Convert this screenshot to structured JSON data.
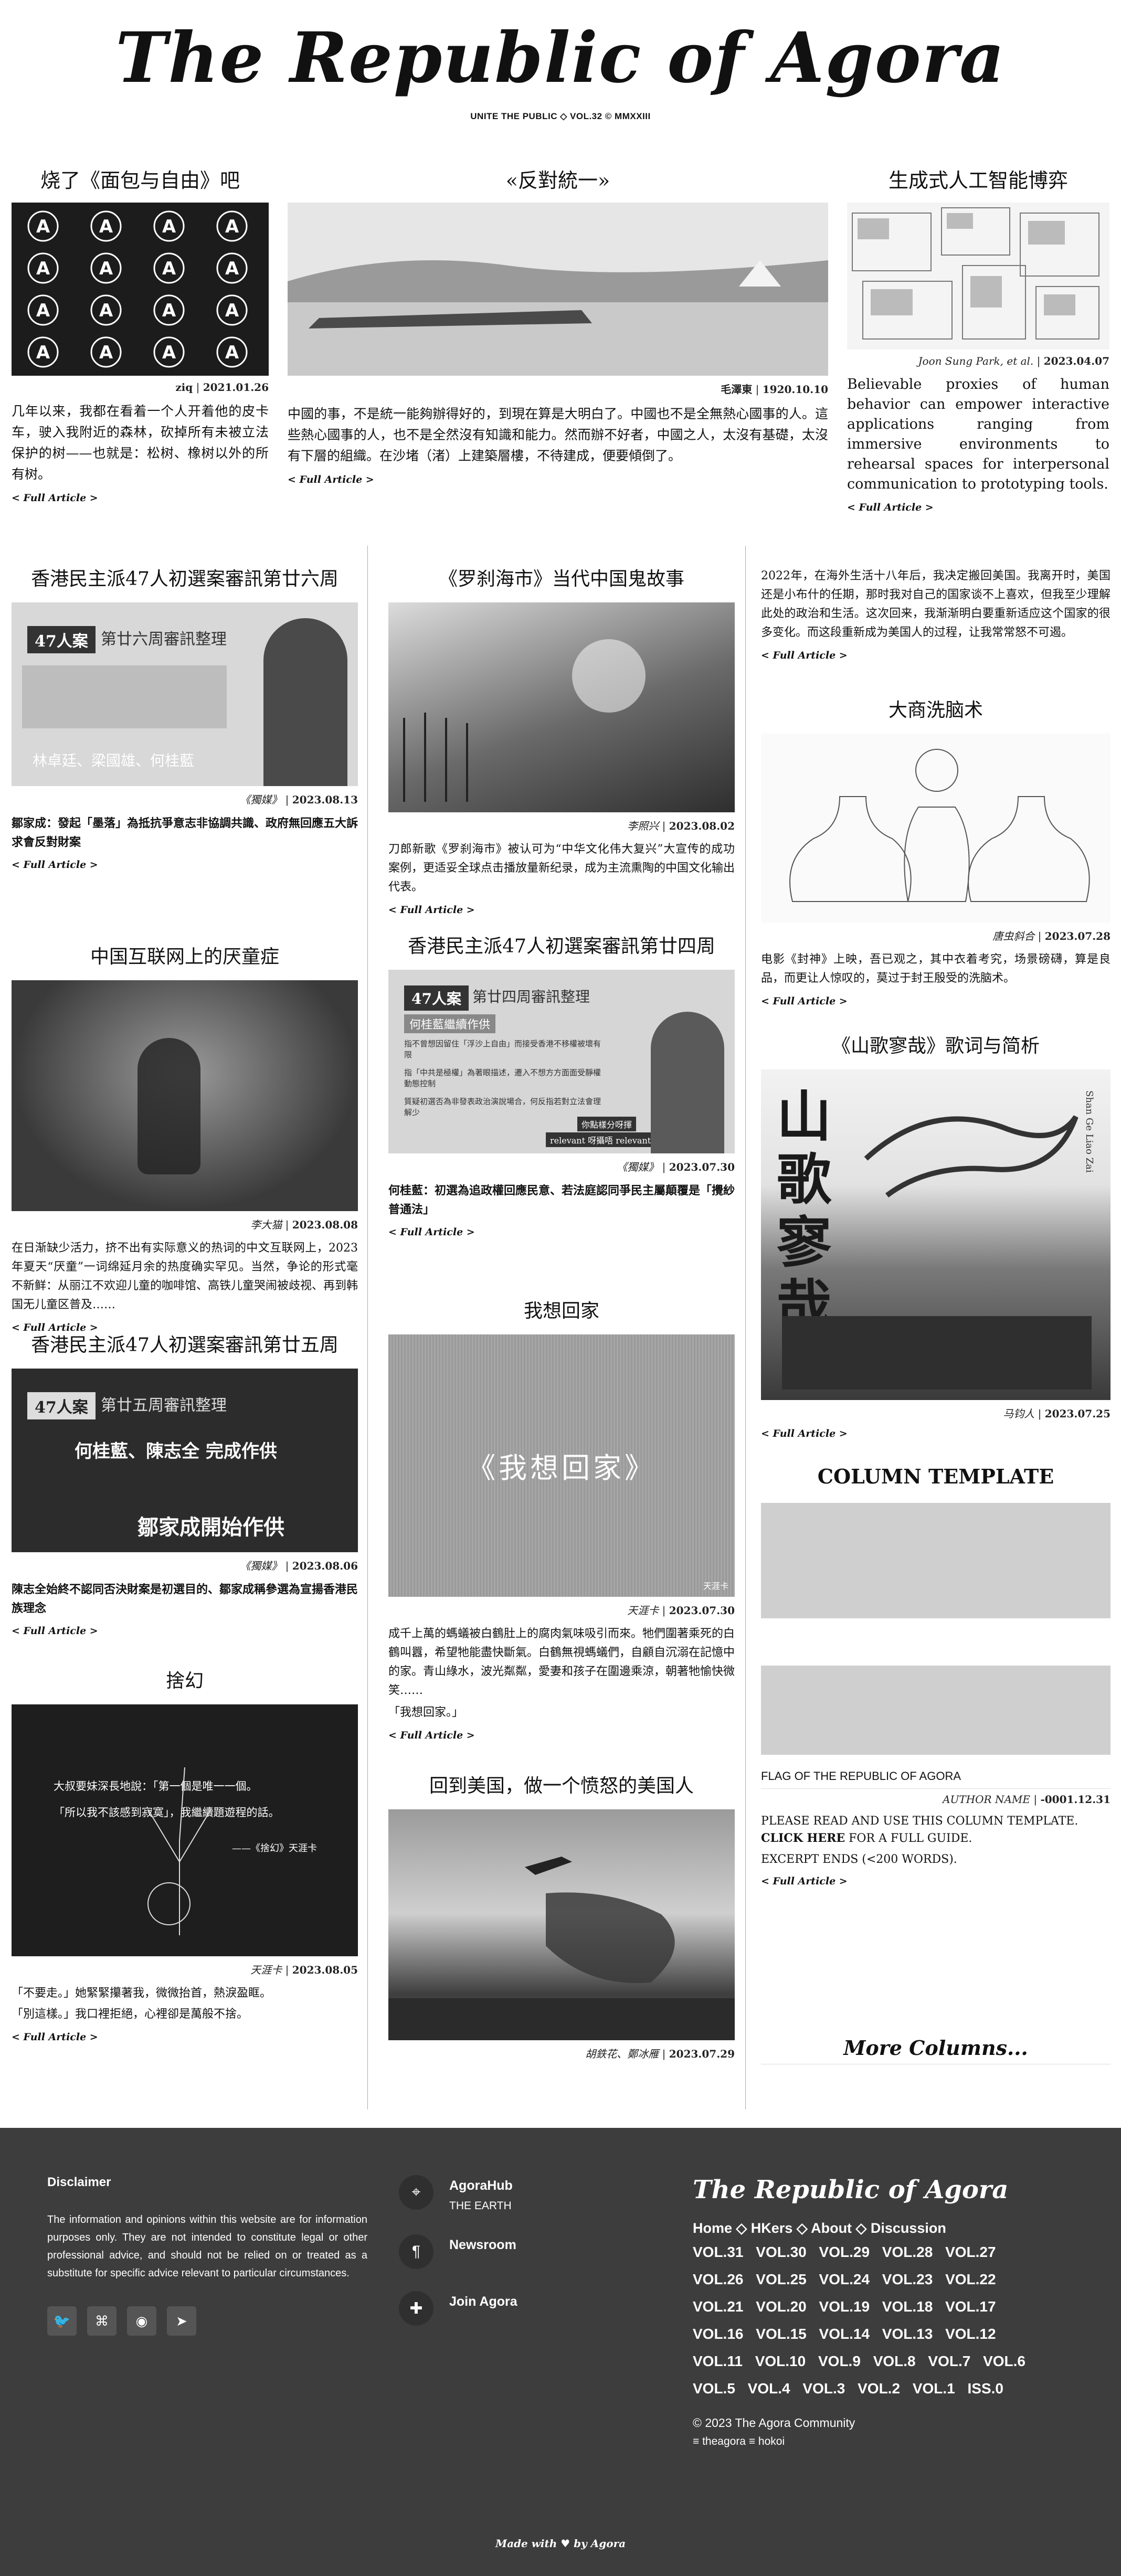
{
  "masthead": {
    "title": "The Republic of Agora",
    "tagline": "UNITE THE PUBLIC ◇ VOL.32 © MMXXIII"
  },
  "row1": [
    {
      "title": "烧了《面包与自由》吧",
      "meta_author": "ziq",
      "meta_date": "2021.01.26",
      "text": "几年以来，我都在看着一个人开着他的皮卡车，驶入我附近的森林，砍掉所有未被立法保护的树——也就是：松树、橡树以外的所有树。",
      "more": "< Full Article >"
    },
    {
      "title": "«反對統一»",
      "meta_author": "毛澤東",
      "meta_date": "1920.10.10",
      "text": "中國的事，不是統一能夠辦得好的，到現在算是大明白了。中國也不是全無熱心國事的人。這些熱心國事的人，也不是全然沒有知識和能力。然而辦不好者，中國之人，太沒有基礎，太沒有下層的組織。在沙堵（渚）上建築層樓，不待建成，便要傾倒了。",
      "more": "< Full Article >"
    },
    {
      "title": "生成式人工智能博弈",
      "meta_author": "Joon Sung Park, et al.",
      "meta_date": "2023.04.07",
      "text": "Believable proxies of human behavior can empower interactive applications ranging from immersive environments to rehearsal spaces for interpersonal communication to prototyping tools.",
      "more": "< Full Article >"
    }
  ],
  "col1": [
    {
      "title": "香港民主派47人初選案審訊第廿六周",
      "img_badge": "47人案",
      "img_title": "第廿六周審訊整理",
      "img_people": "林卓廷、梁國雄、何桂藍",
      "meta_author": "《獨媒》",
      "meta_date": "2023.08.13",
      "text": "鄒家成：發起「墨落」為抵抗爭意志非協調共識、政府無回應五大訴求會反對財案",
      "more": "< Full Article >"
    },
    {
      "title": "中国互联网上的厌童症",
      "meta_author": "李大猫",
      "meta_date": "2023.08.08",
      "text": "在日渐缺少活力，挤不出有实际意义的热词的中文互联网上，2023年夏天“厌童”一词绵延月余的热度确实罕见。当然，争论的形式毫不新鲜：从丽江不欢迎儿童的咖啡馆、高铁儿童哭闹被歧视、再到韩国无儿童区普及……",
      "more": "< Full Article >"
    },
    {
      "title": "香港民主派47人初選案審訊第廿五周",
      "img_badge": "47人案",
      "img_title": "第廿五周審訊整理",
      "img_people": "何桂藍、陳志全 完成作供",
      "img_footer": "鄒家成開始作供",
      "meta_author": "《獨媒》",
      "meta_date": "2023.08.06",
      "text": "陳志全始終不認同否決財案是初選目的、鄒家成稱參選為宣揚香港民族理念",
      "more": "< Full Article >"
    },
    {
      "title": "捨幻",
      "img_quote1": "大叔要妹深長地說：「第一個是唯一一個。",
      "img_quote2": "「所以我不該感到寂寞」，我繼續題遊程的話。",
      "img_quote3": "——《捨幻》天涯卡",
      "meta_author": "天涯卡",
      "meta_date": "2023.08.05",
      "text1": "「不要走。」她緊緊攥著我，微微抬首，熱淚盈眶。",
      "text2": "「別這樣。」我口裡拒絕，心裡卻是萬般不捨。",
      "more": "< Full Article >"
    }
  ],
  "col2": [
    {
      "title": "《罗刹海市》当代中国鬼故事",
      "meta_author": "李照兴",
      "meta_date": "2023.08.02",
      "text": "刀郎新歌《罗刹海市》被认可为“中华文化伟大复兴”大宣传的成功案例，更适妥全球点击播放量新纪录，成为主流熏陶的中国文化输出代表。",
      "more": "< Full Article >"
    },
    {
      "title": "香港民主派47人初選案審訊第廿四周",
      "img_badge": "47人案",
      "img_title": "第廿四周審訊整理",
      "img_sub": "何桂藍繼續作供",
      "img_b1": "指不曾想因留住「浮沙上自由」而接受香港不移權被壞有限",
      "img_b2": "指「中共是極權」為著眼描述，遷入不想方方面面受靜權動態控制",
      "img_b3": "質疑初選否為非發表政治演說場合，何反指若對立法會理解少",
      "img_q": "你點樣分呀揮",
      "img_q2": "relevant 呀攝唔 relevant？",
      "meta_author": "《獨媒》",
      "meta_date": "2023.07.30",
      "text": "何桂藍：初選為追政權回應民意、若法庭認同爭民主屬顛覆是「攪紗普通法」",
      "more": "< Full Article >"
    },
    {
      "title": "我想回家",
      "img_text": "《我想回家》",
      "img_mark": "天涯卡",
      "meta_author": "天涯卡",
      "meta_date": "2023.07.30",
      "text1": "成千上萬的螞蟻被白鶴肚上的腐肉氣味吸引而來。牠們圍著乘死的白鶴叫囂，希望牠能盡快斷氣。白鶴無視螞蟻們，自顧自沉溺在記憶中的家。青山綠水，波光粼粼，愛妻和孩子在圍邊乘涼，朝著牠愉快微笑……",
      "text2": "「我想回家。」",
      "more": "< Full Article >"
    },
    {
      "title": "回到美国，做一个愤怒的美国人",
      "meta_author": "胡鉄花、鄭冰雁",
      "meta_date": "2023.07.29"
    }
  ],
  "col3": [
    {
      "text": "2022年，在海外生活十八年后，我决定搬回美国。我离开时，美国还是小布什的任期，那时我对自己的国家谈不上喜欢，但我至少理解此处的政治和生活。这次回来，我渐渐明白要重新适应这个国家的很多变化。而这段重新成为美国人的过程，让我常常怒不可遏。",
      "more": "< Full Article >"
    },
    {
      "title": "大商洗脑术",
      "meta_author": "唐虫斜合",
      "meta_date": "2023.07.28",
      "text": "电影《封神》上映，吾已观之，其中衣着考究，场景磅礴，算是良品，而更让人惊叹的，莫过于封王殷受的洗脑术。",
      "more": "< Full Article >"
    },
    {
      "title": "《山歌寥哉》歌词与简析",
      "img_text": "山歌寥哉",
      "img_side": "Shan Ge Liao Zai",
      "meta_author": "马钧人",
      "meta_date": "2023.07.25",
      "more": "< Full Article >"
    },
    {
      "title": "COLUMN TEMPLATE",
      "caption": "FLAG OF THE REPUBLIC OF AGORA",
      "meta_author": "AUTHOR NAME",
      "meta_date": "-0001.12.31",
      "text_a": "PLEASE READ AND USE THIS COLUMN TEMPLATE.",
      "text_b_bold": "CLICK HERE",
      "text_b": " FOR A FULL GUIDE.",
      "text_c": "EXCERPT ENDS (<200 WORDS).",
      "more": "< Full Article >"
    },
    {
      "more_columns": "More Columns..."
    }
  ],
  "footer": {
    "disclaimer_title": "Disclaimer",
    "disclaimer_text": "The information and opinions within this website are for information purposes only. They are not intended to constitute legal or other professional advice, and should not be relied on or treated as a substitute for specific advice relevant to particular circumstances.",
    "social_icons": [
      "twitter-icon",
      "github-icon",
      "reddit-icon",
      "telegram-icon"
    ],
    "links": [
      {
        "icon": "map-pin-icon",
        "title": "AgoraHub",
        "sub": "THE EARTH"
      },
      {
        "icon": "paragraph-icon",
        "title": "Newsroom",
        "sub": ""
      },
      {
        "icon": "puzzle-icon",
        "title": "Join Agora",
        "sub": ""
      }
    ],
    "brand": "The Republic of Agora",
    "menu": "Home ◇ HKers ◇ About ◇ Discussion",
    "volumes": [
      "VOL.31",
      "VOL.30",
      "VOL.29",
      "VOL.28",
      "VOL.27",
      "VOL.26",
      "VOL.25",
      "VOL.24",
      "VOL.23",
      "VOL.22",
      "VOL.21",
      "VOL.20",
      "VOL.19",
      "VOL.18",
      "VOL.17",
      "VOL.16",
      "VOL.15",
      "VOL.14",
      "VOL.13",
      "VOL.12",
      "VOL.11",
      "VOL.10",
      "VOL.9",
      "VOL.8",
      "VOL.7",
      "VOL.6",
      "VOL.5",
      "VOL.4",
      "VOL.3",
      "VOL.2",
      "VOL.1",
      "ISS.0"
    ],
    "copyright": "© 2023 The Agora Community",
    "users": "≡ theagora ≡ hokoi",
    "made_with": "Made with ♥ by Agora"
  }
}
